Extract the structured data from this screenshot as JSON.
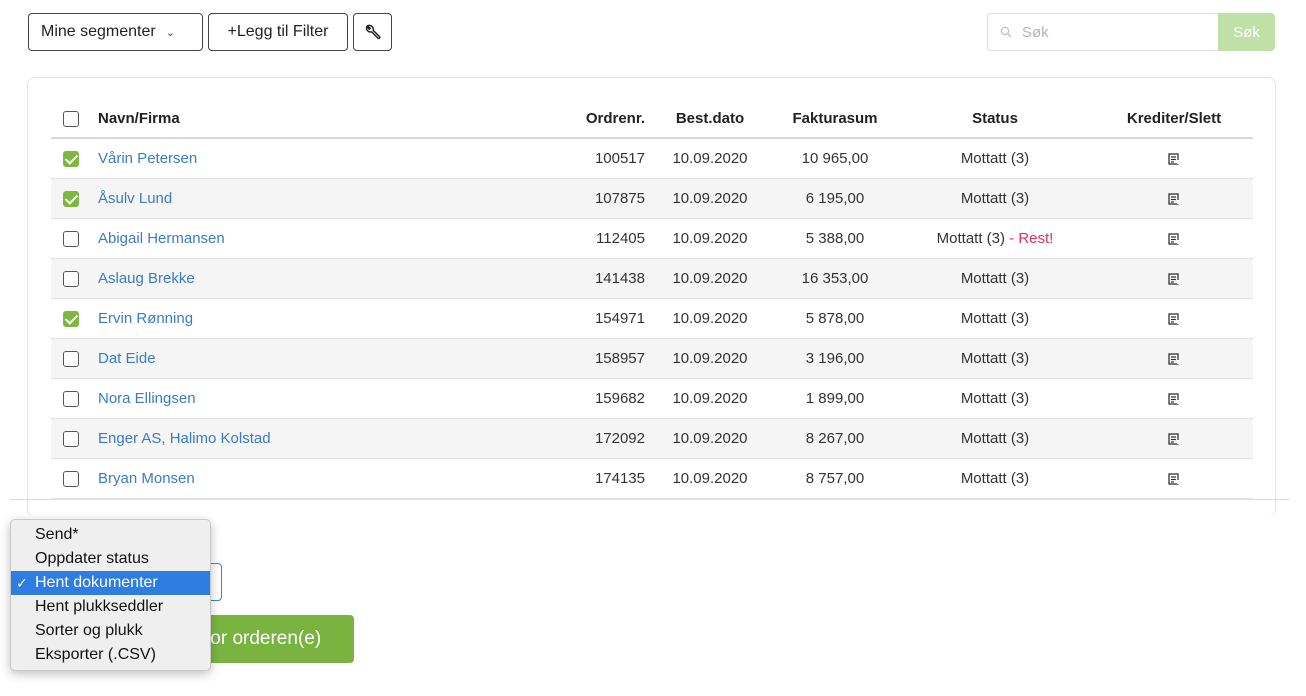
{
  "toolbar": {
    "segments_label": "Mine segmenter",
    "add_filter_label": "+Legg til Filter",
    "search_placeholder": "Søk",
    "search_button": "Søk"
  },
  "table": {
    "headers": {
      "name": "Navn/Firma",
      "order": "Ordrenr.",
      "date": "Best.dato",
      "sum": "Fakturasum",
      "status": "Status",
      "credit": "Krediter/Slett"
    },
    "rows": [
      {
        "checked": true,
        "name": "Vårin Petersen",
        "order": "100517",
        "date": "10.09.2020",
        "sum": "10 965,00",
        "status": "Mottatt (3)",
        "note": ""
      },
      {
        "checked": true,
        "name": "Åsulv Lund",
        "order": "107875",
        "date": "10.09.2020",
        "sum": "6 195,00",
        "status": "Mottatt (3)",
        "note": ""
      },
      {
        "checked": false,
        "name": "Abigail Hermansen",
        "order": "112405",
        "date": "10.09.2020",
        "sum": "5 388,00",
        "status": "Mottatt (3)",
        "note": " - Rest!"
      },
      {
        "checked": false,
        "name": "Aslaug Brekke",
        "order": "141438",
        "date": "10.09.2020",
        "sum": "16 353,00",
        "status": "Mottatt (3)",
        "note": ""
      },
      {
        "checked": true,
        "name": "Ervin Rønning",
        "order": "154971",
        "date": "10.09.2020",
        "sum": "5 878,00",
        "status": "Mottatt (3)",
        "note": ""
      },
      {
        "checked": false,
        "name": "Dat Eide",
        "order": "158957",
        "date": "10.09.2020",
        "sum": "3 196,00",
        "status": "Mottatt (3)",
        "note": ""
      },
      {
        "checked": false,
        "name": "Nora Ellingsen",
        "order": "159682",
        "date": "10.09.2020",
        "sum": "1 899,00",
        "status": "Mottatt (3)",
        "note": ""
      },
      {
        "checked": false,
        "name": "Enger AS, Halimo Kolstad",
        "order": "172092",
        "date": "10.09.2020",
        "sum": "8 267,00",
        "status": "Mottatt (3)",
        "note": ""
      },
      {
        "checked": false,
        "name": "Bryan Monsen",
        "order": "174135",
        "date": "10.09.2020",
        "sum": "8 757,00",
        "status": "Mottatt (3)",
        "note": ""
      }
    ]
  },
  "actions": {
    "dropdown_options": [
      "Send*",
      "Oppdater status",
      "Hent dokumenter",
      "Hent plukkseddler",
      "Sorter og plukk",
      "Eksporter (.CSV)"
    ],
    "selected_index": 2,
    "selected_tick": "✓",
    "execute_button_visible": "for orderen(e)"
  },
  "colors": {
    "accent_green": "#79b441",
    "link_blue": "#3a7cc6",
    "alert_red": "#e0305b",
    "selection_blue": "#2f7de1"
  }
}
